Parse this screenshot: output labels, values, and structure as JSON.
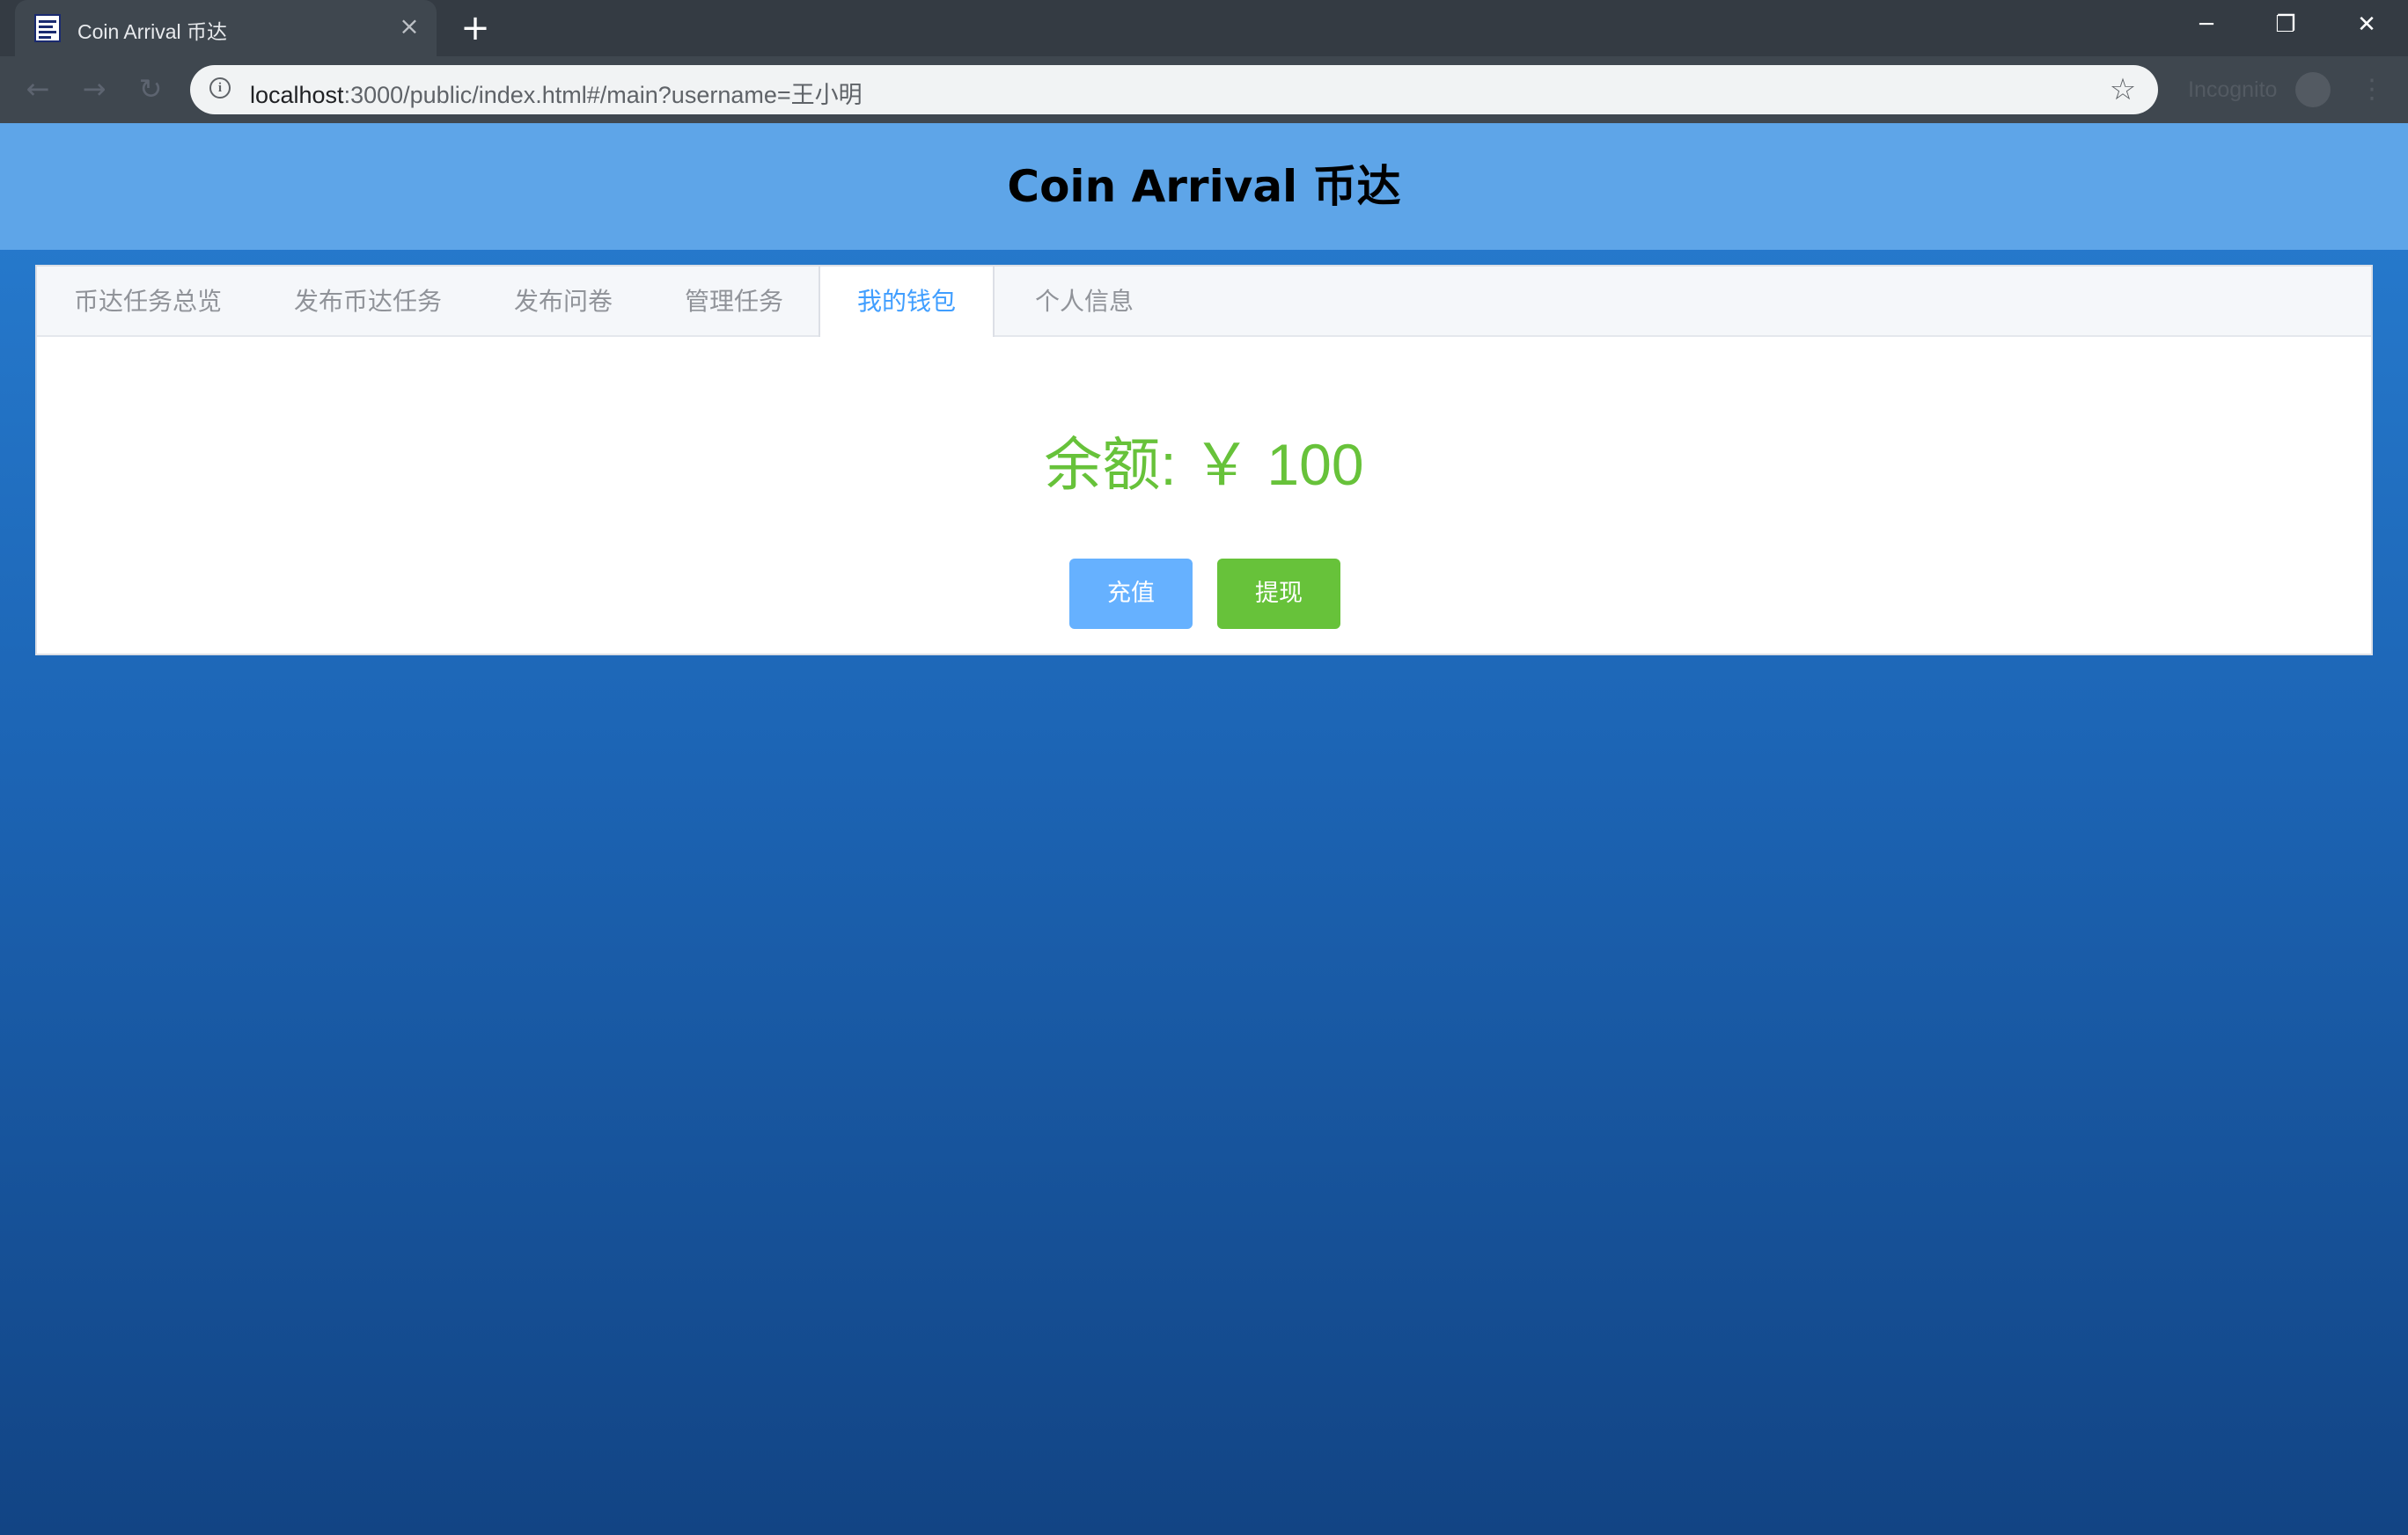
{
  "browser": {
    "tab_title": "Coin Arrival 币达",
    "tab_close": "×",
    "new_tab": "+",
    "url_host": "localhost",
    "url_path": ":3000/public/index.html#/main?username=王小明",
    "incognito_label": "Incognito",
    "window_buttons": {
      "minimize": "─",
      "restore": "❐",
      "close": "✕"
    },
    "nav": {
      "back": "←",
      "forward": "→",
      "reload": "↻"
    },
    "star": "☆",
    "menu": "⋮",
    "info": "i"
  },
  "app": {
    "title": "Coin Arrival 币达"
  },
  "tabs": [
    {
      "label": "币达任务总览",
      "active": false
    },
    {
      "label": "发布币达任务",
      "active": false
    },
    {
      "label": "发布问卷",
      "active": false
    },
    {
      "label": "管理任务",
      "active": false
    },
    {
      "label": "我的钱包",
      "active": true
    },
    {
      "label": "个人信息",
      "active": false
    }
  ],
  "wallet": {
    "balance_text": "余额: ￥ 100",
    "recharge_label": "充值",
    "withdraw_label": "提现"
  },
  "colors": {
    "header": "#5ea5e8",
    "accent": "#409eff",
    "success": "#67c23a",
    "recharge_button": "#66b1ff"
  }
}
